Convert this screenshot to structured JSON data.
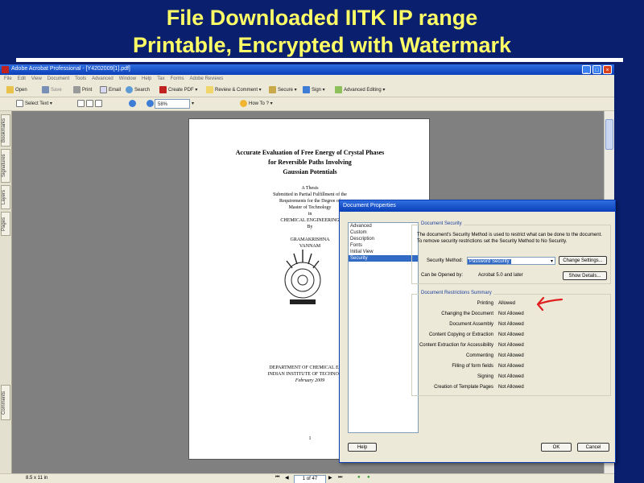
{
  "slide": {
    "title_line1": "File Downloaded IITK IP range",
    "title_line2": "Printable, Encrypted with Watermark"
  },
  "acrobat": {
    "window_title": "Adobe Acrobat Professional - [Y4202009[1].pdf]",
    "menus": [
      "File",
      "Edit",
      "View",
      "Document",
      "Tools",
      "Advanced",
      "Window",
      "Help",
      "Tax",
      "Forms",
      "Adobe Reviews"
    ],
    "toolbar1": {
      "open": "Open",
      "save": "Save",
      "print": "Print",
      "email": "Email",
      "search": "Search",
      "create_pdf": "Create PDF",
      "review_comment": "Review & Comment",
      "secure": "Secure",
      "sign": "Sign",
      "advanced_editing": "Advanced Editing"
    },
    "toolbar2": {
      "select_text": "Select Text",
      "zoom": "58%",
      "how_to": "How To ?"
    },
    "side_tabs": [
      "Bookmarks",
      "Signatures",
      "Layers",
      "Pages",
      "Comments"
    ],
    "status": {
      "page_size": "8.5 x 11 in",
      "page_indicator": "1 of 47"
    }
  },
  "document_page": {
    "title": [
      "Accurate Evaluation of Free Energy of Crystal Phases",
      "for Reversible Paths Involving",
      "Gaussian Potentials"
    ],
    "lines": [
      "A Thesis",
      "Submitted in Partial Fulfillment of the",
      "Requirements for the Degree of",
      "Master of Technology",
      "in",
      "CHEMICAL ENGINEERING",
      "By"
    ],
    "author": [
      "GRAMAKRISHNA",
      "VANNAM"
    ],
    "department": [
      "DEPARTMENT OF CHEMICAL ENGIN",
      "INDIAN INSTITUTE OF TECHNOLOGY",
      "February 2009"
    ],
    "page_number": "1"
  },
  "dialog": {
    "title": "Document Properties",
    "categories": [
      {
        "label": "Advanced"
      },
      {
        "label": "Custom"
      },
      {
        "label": "Description"
      },
      {
        "label": "Fonts"
      },
      {
        "label": "Initial View"
      },
      {
        "label": "Security"
      }
    ],
    "selected_category": "Security",
    "security_group_label": "Document Security",
    "security_description": "The document's Security Method is used to restrict what can be done to the document. To remove security restrictions set the Security Method to No Security.",
    "security_method_label": "Security Method:",
    "security_method_value": "Password Security",
    "change_settings": "Change Settings...",
    "opened_by_label": "Can be Opened by:",
    "opened_by_value": "Acrobat 5.0 and later",
    "show_details": "Show Details...",
    "restrictions_group_label": "Document Restrictions Summary",
    "restrictions": [
      {
        "label": "Printing",
        "value": "Allowed"
      },
      {
        "label": "Changing the Document",
        "value": "Not Allowed"
      },
      {
        "label": "Document Assembly",
        "value": "Not Allowed"
      },
      {
        "label": "Content Copying or Extraction",
        "value": "Not Allowed"
      },
      {
        "label": "Content Extraction for Accessibility",
        "value": "Not Allowed"
      },
      {
        "label": "Commenting",
        "value": "Not Allowed"
      },
      {
        "label": "Filling of form fields",
        "value": "Not Allowed"
      },
      {
        "label": "Signing",
        "value": "Not Allowed"
      },
      {
        "label": "Creation of Template Pages",
        "value": "Not Allowed"
      }
    ],
    "help": "Help",
    "ok": "OK",
    "cancel": "Cancel"
  },
  "colors": {
    "slide_background": "#0a1f6e",
    "slide_title": "#ffff66",
    "annotation_arrow": "#e02020",
    "selection": "#316ac5"
  },
  "icons": [
    "open-icon",
    "save-icon",
    "print-icon",
    "email-icon",
    "search-icon",
    "create-pdf-icon",
    "review-icon",
    "secure-icon",
    "sign-icon",
    "advanced-editing-icon",
    "select-text-icon",
    "zoom-icon",
    "help-icon"
  ]
}
